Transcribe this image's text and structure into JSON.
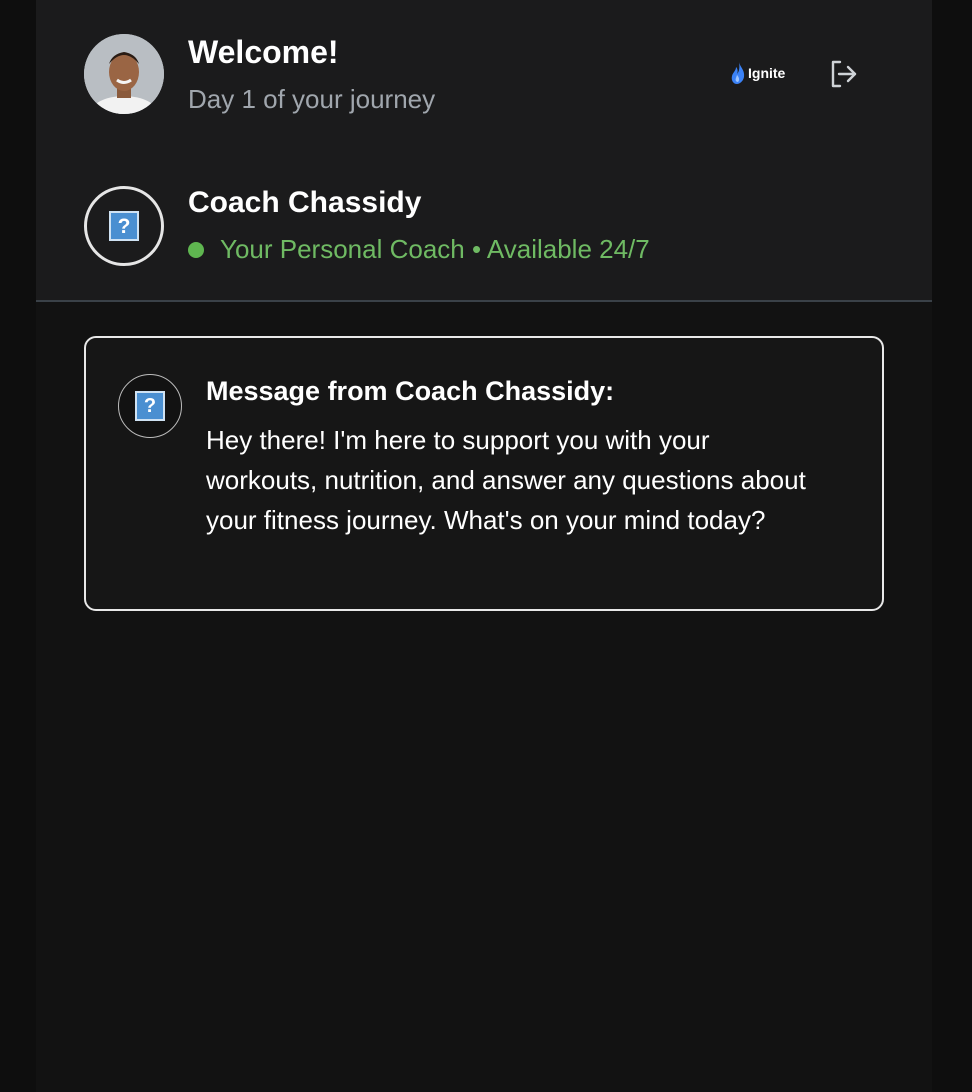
{
  "header": {
    "welcome": "Welcome!",
    "day_text": "Day 1 of your journey",
    "brand": {
      "name": "Ignite",
      "icon": "flame-icon",
      "accent": "#3b82f6"
    },
    "logout_icon": "logout-icon"
  },
  "coach": {
    "name": "Coach Chassidy",
    "status": "Your Personal Coach • Available 24/7",
    "status_color": "#6fba63",
    "avatar_icon": "missing-image-icon"
  },
  "message": {
    "title": "Message from Coach Chassidy:",
    "body": "Hey there! I'm here to support you with your workouts, nutrition, and answer any questions about your fitness journey. What's on your mind today?",
    "avatar_icon": "missing-image-icon"
  },
  "colors": {
    "background": "#121212",
    "header_bg": "#1b1b1c",
    "muted_text": "#a0a6ad"
  }
}
